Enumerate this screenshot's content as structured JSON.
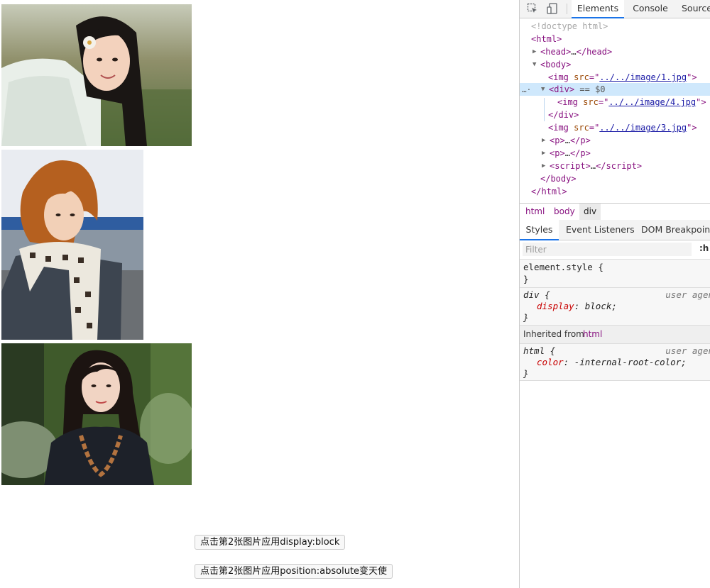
{
  "page": {
    "images": [
      {
        "name": "photo-girl-white-jacket"
      },
      {
        "name": "photo-girl-scarf"
      },
      {
        "name": "photo-girl-necklace"
      }
    ],
    "buttons": {
      "display_block": "点击第2张图片应用display:block",
      "position_absolute": "点击第2张图片应用position:absolute变天使"
    }
  },
  "devtools": {
    "tabs": {
      "elements": "Elements",
      "console": "Console",
      "sources": "Source"
    },
    "dom": {
      "doctype": "<!doctype html>",
      "html_open": "<html>",
      "head": "head",
      "head_ellipsis": "…",
      "body": "body",
      "img": "img",
      "src_attr": "src",
      "img1_src": "../../image/1.jpg",
      "div": "div",
      "selected_marker": "== $0",
      "img4_src": "../../image/4.jpg",
      "img3_src": "../../image/3.jpg",
      "p": "p",
      "script": "script",
      "ellipsis": "…",
      "row_dots": "…",
      "body_close": "</body>",
      "html_close": "</html>",
      "div_close": "</div>"
    },
    "breadcrumbs": [
      "html",
      "body",
      "div"
    ],
    "styles_tabs": {
      "styles": "Styles",
      "listeners": "Event Listeners",
      "dom_breakpoints": "DOM Breakpoints"
    },
    "filter": {
      "placeholder": "Filter",
      "value": "",
      "toggle": ":h"
    },
    "rules": {
      "element_style": {
        "selector": "element.style {",
        "close": "}"
      },
      "div_rule": {
        "selector": "div",
        "open": " {",
        "source": "user agen",
        "property": "display",
        "value": "block;",
        "close": "}"
      },
      "inherited_label": "Inherited from",
      "inherited_tag": "html",
      "html_rule": {
        "selector": "html",
        "open": " {",
        "source": "user agen",
        "property": "color",
        "value": "-internal-root-color;",
        "close": "}"
      }
    }
  }
}
